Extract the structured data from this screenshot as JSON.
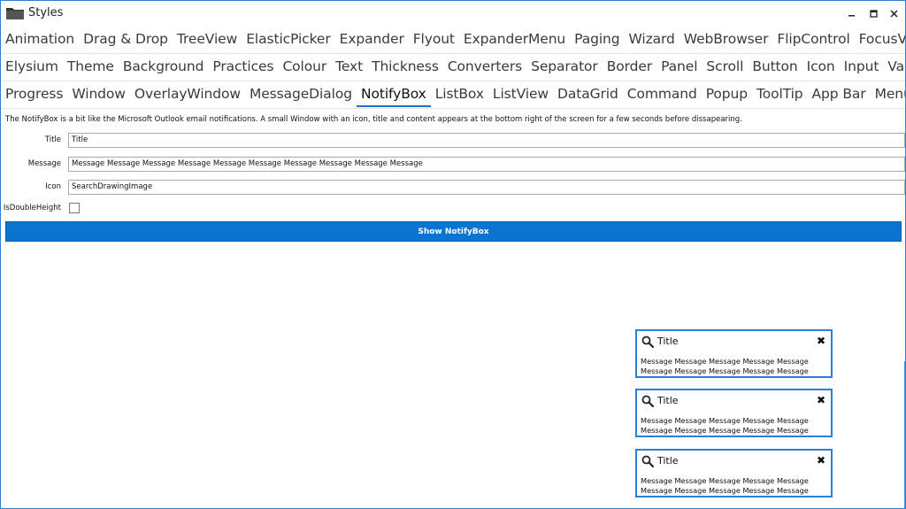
{
  "window": {
    "title": "Styles"
  },
  "tabs": {
    "row1": [
      "Animation",
      "Drag & Drop",
      "TreeView",
      "ElasticPicker",
      "Expander",
      "Flyout",
      "ExpanderMenu",
      "Paging",
      "Wizard",
      "WebBrowser",
      "FlipControl",
      "FocusVisualStyle"
    ],
    "row2": [
      "Elysium",
      "Theme",
      "Background",
      "Practices",
      "Colour",
      "Text",
      "Thickness",
      "Converters",
      "Separator",
      "Border",
      "Panel",
      "Scroll",
      "Button",
      "Icon",
      "Input",
      "Validation"
    ],
    "row3": [
      "Progress",
      "Window",
      "OverlayWindow",
      "MessageDialog",
      "NotifyBox",
      "ListBox",
      "ListView",
      "DataGrid",
      "Command",
      "Popup",
      "ToolTip",
      "App Bar",
      "MenuItem"
    ],
    "active": "NotifyBox"
  },
  "description": "The NotifyBox is a bit like the Microsoft Outlook email notifications. A small Window with an icon, title and content appears at the bottom right of the screen for a few seconds before dissapearing.",
  "form": {
    "title_label": "Title",
    "title_value": "Title",
    "message_label": "Message",
    "message_value": "Message Message Message Message Message Message Message Message Message Message",
    "icon_label": "Icon",
    "icon_value": "SearchDrawingImage",
    "double_height_label": "IsDoubleHeight",
    "double_height_checked": false
  },
  "show_button_label": "Show NotifyBox",
  "notifications": [
    {
      "icon": "search-icon",
      "title": "Title",
      "message": "Message Message Message Message Message Message Message Message Message Message"
    },
    {
      "icon": "search-icon",
      "title": "Title",
      "message": "Message Message Message Message Message Message Message Message Message Message"
    },
    {
      "icon": "search-icon",
      "title": "Title",
      "message": "Message Message Message Message Message Message Message Message Message Message"
    }
  ],
  "colors": {
    "accent": "#0a74d0",
    "border": "#2d7fd6"
  }
}
